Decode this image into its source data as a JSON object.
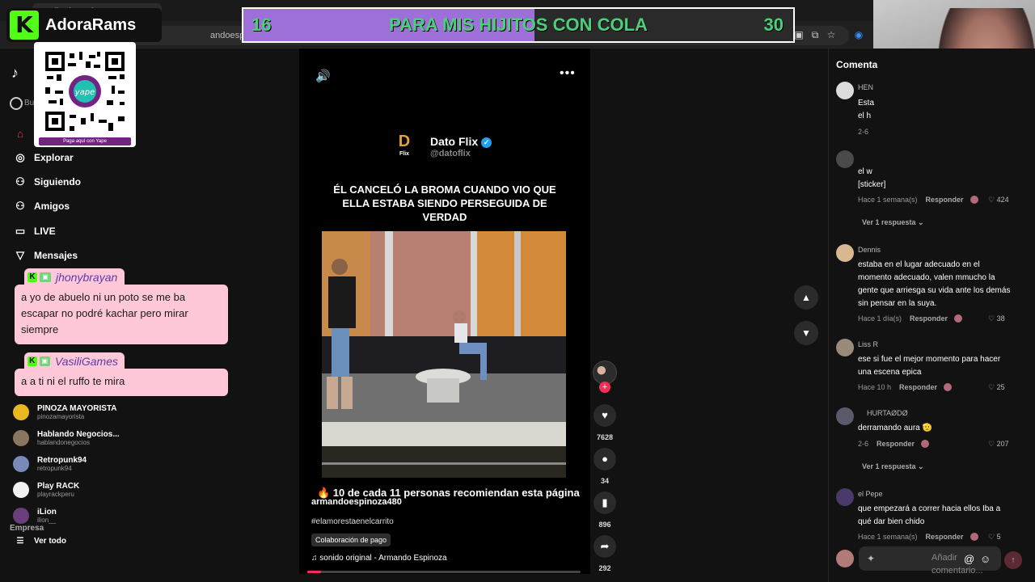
{
  "browser": {
    "tab_title": "TikTok - Make Your Day",
    "url": "andoespinoza480/video"
  },
  "stream": {
    "channel_name": "AdoraRams",
    "qr_caption": "Paga aquí con Yape",
    "goal": {
      "current": "16",
      "title": "PARA MIS HIJITOS CON COLA",
      "target": "30",
      "progress": 0.53
    }
  },
  "sidebar": {
    "search_placeholder": "Bu",
    "nav": [
      {
        "icon": "⌂",
        "label": ""
      },
      {
        "icon": "◎",
        "label": "Explorar"
      },
      {
        "icon": "⚇",
        "label": "Siguiendo"
      },
      {
        "icon": "⚇",
        "label": "Amigos"
      },
      {
        "icon": "▭",
        "label": "LIVE"
      },
      {
        "icon": "▽",
        "label": "Mensajes"
      }
    ],
    "accounts": [
      {
        "name": "PINOZA MAYORISTA",
        "handle": "pinozamayorista",
        "color": "#e8b820"
      },
      {
        "name": "Hablando Negocios...",
        "handle": "hablandonegocios",
        "color": "#8a7560"
      },
      {
        "name": "Retropunk94",
        "handle": "retropunk94",
        "color": "#7a8ab8"
      },
      {
        "name": "Play RACK",
        "handle": "playrackperu",
        "color": "#f2f2f2"
      },
      {
        "name": "iLion",
        "handle": "ilion__",
        "color": "#6a3e7a"
      }
    ],
    "see_all": "Ver todo",
    "footer": "Empresa"
  },
  "chat": [
    {
      "user": "jhonybrayan",
      "message": "a yo de abuelo ni un poto se me ba escapar no podré kachar pero mirar siempre"
    },
    {
      "user": "VasiliGames",
      "message": "a a ti ni el ruffo te mira"
    }
  ],
  "video": {
    "channel_name": "Dato Flix",
    "channel_handle": "@datoflix",
    "logo_letter": "D",
    "logo_sub": "Flix",
    "headline": "ÉL CANCELÓ LA BROMA CUANDO VIO QUE ELLA ESTABA SIENDO PERSEGUIDA DE VERDAD",
    "cta": "🔥 10 de cada 11 personas recomiendan esta página",
    "author": "armandoespinoza480",
    "hashtag": "#elamorestaenelcarrito",
    "collab_label": "Colaboración de pago",
    "music": "♫  sonido original - Armando Espinoza",
    "progress": 0.05,
    "likes": "7628",
    "comments_count": "34",
    "saves": "896",
    "shares": "292"
  },
  "comments": {
    "title": "Comenta",
    "add_placeholder": "Añadir comentario...",
    "items": [
      {
        "user": "HEN",
        "text": "Esta el h",
        "meta": "2-6",
        "reply": "",
        "likes": "",
        "color": "#dcdcdc"
      },
      {
        "user": "",
        "text": "el w [sticker]",
        "meta": "Hace 1 semana(s)",
        "reply": "Responder",
        "likes": "♡ 424",
        "color": "#4a4a4a"
      },
      {
        "user": "Dennis",
        "text": "estaba en el lugar adecuado en el momento adecuado, valen mmucho la gente que arriesga su vida ante los demás sin pensar en la suya.",
        "meta": "Hace 1 día(s)",
        "reply": "Responder",
        "likes": "♡ 38",
        "color": "#d8b890"
      },
      {
        "user": "Liss R",
        "text": "ese si fue el mejor momento para hacer una escena epica",
        "meta": "Hace 10 h",
        "reply": "Responder",
        "likes": "♡ 25",
        "color": "#9a8a7a"
      },
      {
        "user": "HURTAØDØ",
        "text": "derramando aura 🫡",
        "meta": "2-6",
        "reply": "Responder",
        "likes": "♡ 207",
        "color": "#5a5a6a"
      },
      {
        "user": "el Pepe",
        "text": "que empezará a correr hacia ellos Iba a qué dar bien chido",
        "meta": "Hace 1 semana(s)",
        "reply": "Responder",
        "likes": "♡ 5",
        "color": "#4a3a6a"
      }
    ],
    "view_replies": "Ver 1 respuesta ⌄"
  }
}
